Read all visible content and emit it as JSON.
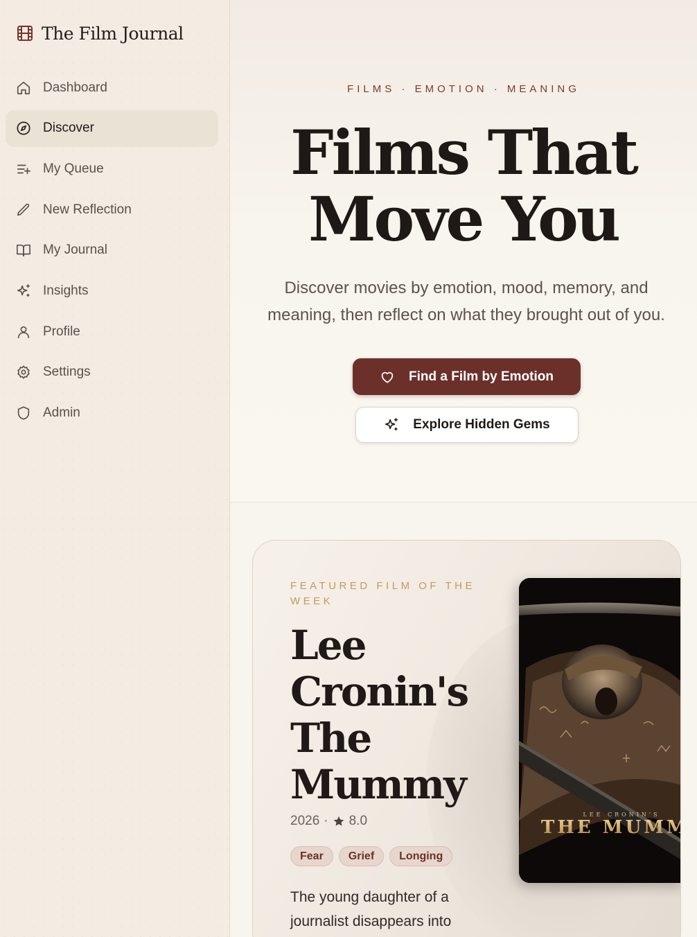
{
  "app": {
    "title": "The Film Journal"
  },
  "sidebar": {
    "items": [
      {
        "label": "Dashboard",
        "icon": "home-icon",
        "active": false
      },
      {
        "label": "Discover",
        "icon": "compass-icon",
        "active": true
      },
      {
        "label": "My Queue",
        "icon": "list-plus-icon",
        "active": false
      },
      {
        "label": "New Reflection",
        "icon": "pencil-icon",
        "active": false
      },
      {
        "label": "My Journal",
        "icon": "book-open-icon",
        "active": false
      },
      {
        "label": "Insights",
        "icon": "sparkles-icon",
        "active": false
      },
      {
        "label": "Profile",
        "icon": "user-icon",
        "active": false
      },
      {
        "label": "Settings",
        "icon": "gear-icon",
        "active": false
      },
      {
        "label": "Admin",
        "icon": "shield-icon",
        "active": false
      }
    ]
  },
  "hero": {
    "eyebrow": "FILMS · EMOTION · MEANING",
    "title_line1": "Films That",
    "title_line2": "Move You",
    "subtitle": "Discover movies by emotion, mood, memory, and meaning, then reflect on what they brought out of you.",
    "primary_button": "Find a Film by Emotion",
    "secondary_button": "Explore Hidden Gems"
  },
  "featured": {
    "eyebrow": "FEATURED FILM OF THE WEEK",
    "title": "Lee Cronin's The Mummy",
    "year": "2026",
    "separator": "·",
    "rating": "8.0",
    "tags": [
      "Fear",
      "Grief",
      "Longing"
    ],
    "description": "The young daughter of a journalist disappears into",
    "poster": {
      "small_text": "LEE CRONIN'S",
      "big_text": "THE MUMM"
    }
  },
  "colors": {
    "accent": "#6b302a",
    "sidebar_bg": "#f4ece3",
    "main_bg": "#f8f4ee",
    "gold": "#c39a5e"
  }
}
